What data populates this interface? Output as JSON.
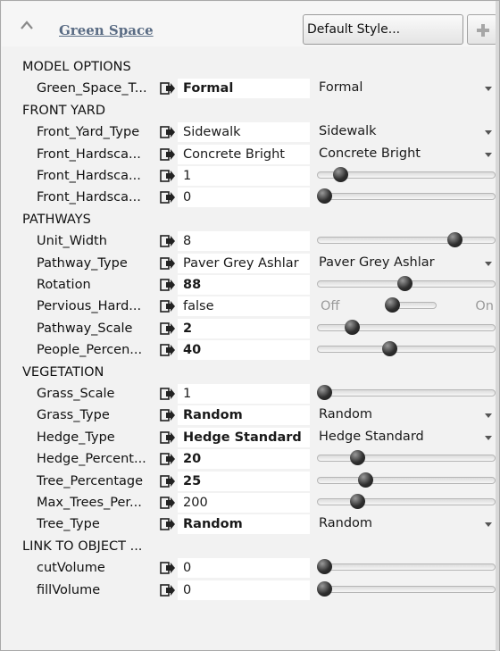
{
  "header": {
    "title": "Green Space",
    "style_button": "Default Style...",
    "add_icon": "plus-icon",
    "collapse_icon": "chevron-up-icon"
  },
  "link_icon": "link-arrow-icon",
  "sections": [
    {
      "label": "MODEL OPTIONS"
    },
    {
      "label": "FRONT YARD"
    },
    {
      "label": "PATHWAYS"
    },
    {
      "label": "VEGETATION"
    },
    {
      "label": "LINK TO OBJECT ..."
    }
  ],
  "params": [
    {
      "label": "Green_Space_T...",
      "value": "Formal",
      "bold": true,
      "control": "combo",
      "option": "Formal"
    },
    {
      "label": "Front_Yard_Type",
      "value": "Sidewalk",
      "bold": false,
      "control": "combo",
      "option": "Sidewalk"
    },
    {
      "label": "Front_Hardsca...",
      "value": "Concrete Bright",
      "bold": false,
      "control": "combo",
      "option": "Concrete Bright"
    },
    {
      "label": "Front_Hardsca...",
      "value": "1",
      "bold": false,
      "control": "slider",
      "level": 0.1
    },
    {
      "label": "Front_Hardsca...",
      "value": "0",
      "bold": false,
      "control": "slider",
      "level": 0.0
    },
    {
      "label": "Unit_Width",
      "value": "8",
      "bold": false,
      "control": "slider",
      "level": 0.8
    },
    {
      "label": "Pathway_Type",
      "value": "Paver Grey Ashlar",
      "bold": false,
      "control": "combo",
      "option": "Paver Grey Ashlar"
    },
    {
      "label": "Rotation",
      "value": "88",
      "bold": true,
      "control": "slider",
      "level": 0.49
    },
    {
      "label": "Pervious_Hard...",
      "value": "false",
      "bold": false,
      "control": "toggle",
      "off_label": "Off",
      "on_label": "On"
    },
    {
      "label": "Pathway_Scale",
      "value": "2",
      "bold": true,
      "control": "slider",
      "level": 0.17
    },
    {
      "label": "People_Percen...",
      "value": "40",
      "bold": true,
      "control": "slider",
      "level": 0.4
    },
    {
      "label": "Grass_Scale",
      "value": "1",
      "bold": false,
      "control": "slider",
      "level": 0.0
    },
    {
      "label": "Grass_Type",
      "value": "Random",
      "bold": true,
      "control": "combo",
      "option": "Random"
    },
    {
      "label": "Hedge_Type",
      "value": "Hedge Standard",
      "bold": true,
      "control": "combo",
      "option": "Hedge Standard"
    },
    {
      "label": "Hedge_Percent...",
      "value": "20",
      "bold": true,
      "control": "slider",
      "level": 0.2
    },
    {
      "label": "Tree_Percentage",
      "value": "25",
      "bold": true,
      "control": "slider",
      "level": 0.25
    },
    {
      "label": "Max_Trees_Per...",
      "value": "200",
      "bold": false,
      "control": "slider",
      "level": 0.2
    },
    {
      "label": "Tree_Type",
      "value": "Random",
      "bold": true,
      "control": "combo",
      "option": "Random"
    },
    {
      "label": "cutVolume",
      "value": "0",
      "bold": false,
      "control": "slider",
      "level": 0.0
    },
    {
      "label": "fillVolume",
      "value": "0",
      "bold": false,
      "control": "slider",
      "level": 0.0
    }
  ]
}
